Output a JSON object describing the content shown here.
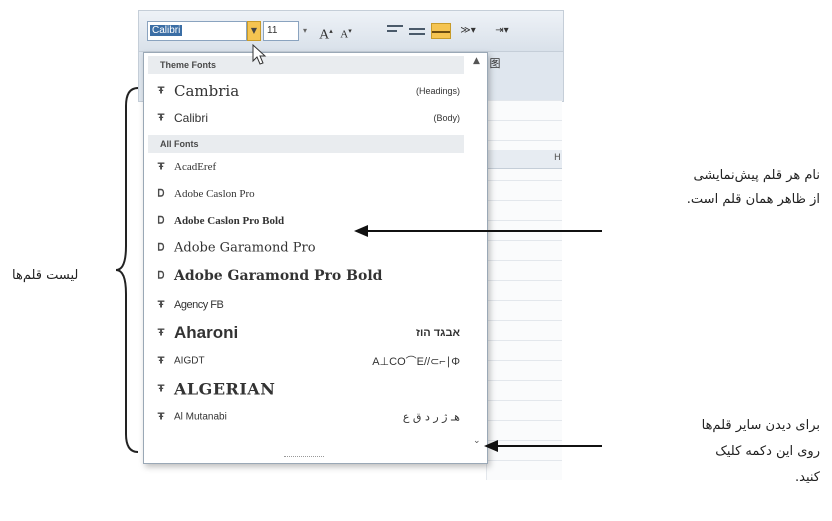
{
  "toolbar": {
    "font_value": "Calibri",
    "size_value": "11",
    "grow_font": "A",
    "shrink_font": "A",
    "ribbon_row2_text": "Ę 图"
  },
  "grid": {
    "column_letter": "H"
  },
  "dropdown": {
    "theme_header": "Theme Fonts",
    "all_header": "All Fonts",
    "theme_fonts": [
      {
        "icon": "truetype-icon",
        "glyph": "Ŧ",
        "name": "Cambria",
        "tag": "(Headings)"
      },
      {
        "icon": "truetype-icon",
        "glyph": "Ŧ",
        "name": "Calibri",
        "tag": "(Body)"
      }
    ],
    "all_fonts": [
      {
        "icon": "truetype-icon",
        "glyph": "Ŧ",
        "name": "AcadEref",
        "tag": ""
      },
      {
        "icon": "opentype-icon",
        "glyph": "Ꭰ",
        "name": "Adobe Caslon Pro",
        "tag": ""
      },
      {
        "icon": "opentype-icon",
        "glyph": "Ꭰ",
        "name": "Adobe Caslon Pro Bold",
        "tag": ""
      },
      {
        "icon": "opentype-icon",
        "glyph": "Ꭰ",
        "name": "Adobe Garamond Pro",
        "tag": ""
      },
      {
        "icon": "opentype-icon",
        "glyph": "Ꭰ",
        "name": "Adobe Garamond Pro Bold",
        "tag": ""
      },
      {
        "icon": "truetype-icon",
        "glyph": "Ŧ",
        "name": "Agency FB",
        "tag": ""
      },
      {
        "icon": "truetype-icon",
        "glyph": "Ŧ",
        "name": "Aharoni",
        "tag": "אבגד הוז"
      },
      {
        "icon": "truetype-icon",
        "glyph": "Ŧ",
        "name": "AIGDT",
        "tag": "A⊥CO⌒E//⊂⌐∣Φ"
      },
      {
        "icon": "truetype-icon",
        "glyph": "Ŧ",
        "name": "ALGERIAN",
        "tag": ""
      },
      {
        "icon": "truetype-icon",
        "glyph": "Ŧ",
        "name": "Al Mutanabi",
        "tag": "هـ ژ ر د ق ع"
      }
    ]
  },
  "annotations": {
    "font_list_label": "لیست قلم‌ها",
    "preview_line1": "نام هر قلم پیش‌نمایشی",
    "preview_line2": "از ظاهر همان قلم است.",
    "more_line1": "برای دیدن سایر قلم‌ها",
    "more_line2": "روی این دکمه کلیک",
    "more_line3": "کنید."
  }
}
